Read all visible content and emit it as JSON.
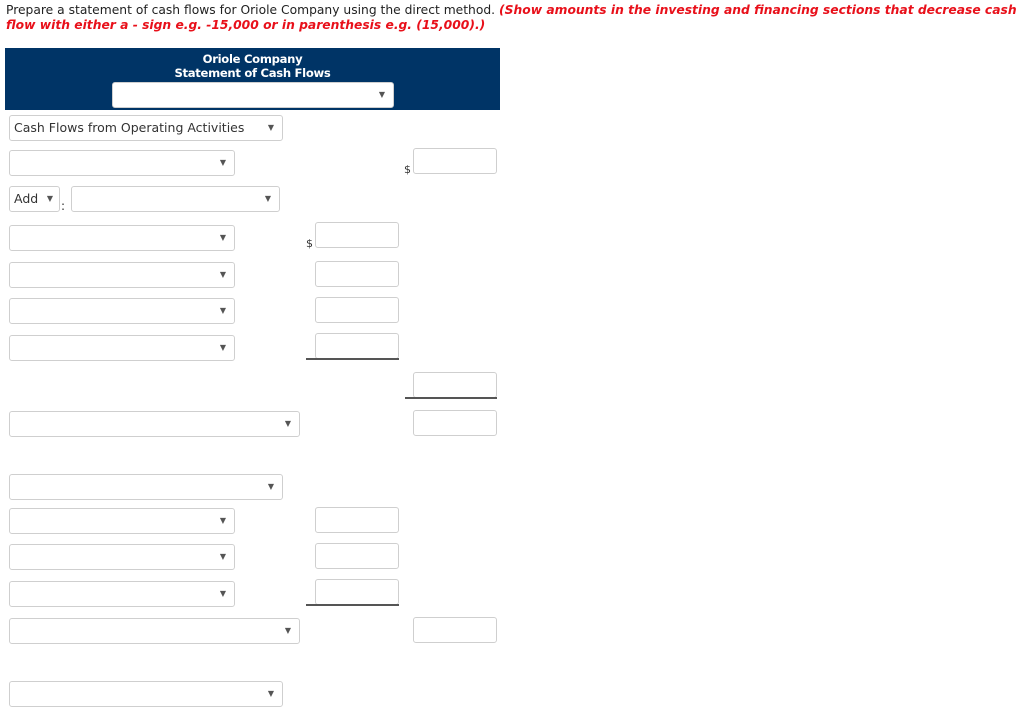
{
  "instructions": {
    "text": "Prepare a statement of cash flows for Oriole Company using the direct method.",
    "note": "(Show amounts in the investing and financing sections that decrease cash flow with either a - sign e.g. -15,000 or in parenthesis e.g. (15,000).)"
  },
  "header": {
    "company": "Oriole Company",
    "statement": "Statement of Cash Flows",
    "period_select": ""
  },
  "sections": {
    "operating_label": "Cash Flows from Operating Activities",
    "add_label": "Add",
    "colon": ":"
  },
  "icons": {
    "dropdown_arrow": "▼"
  },
  "currency_symbol": "$",
  "colors": {
    "header_bg": "#003466",
    "note_red": "#e8101a"
  }
}
